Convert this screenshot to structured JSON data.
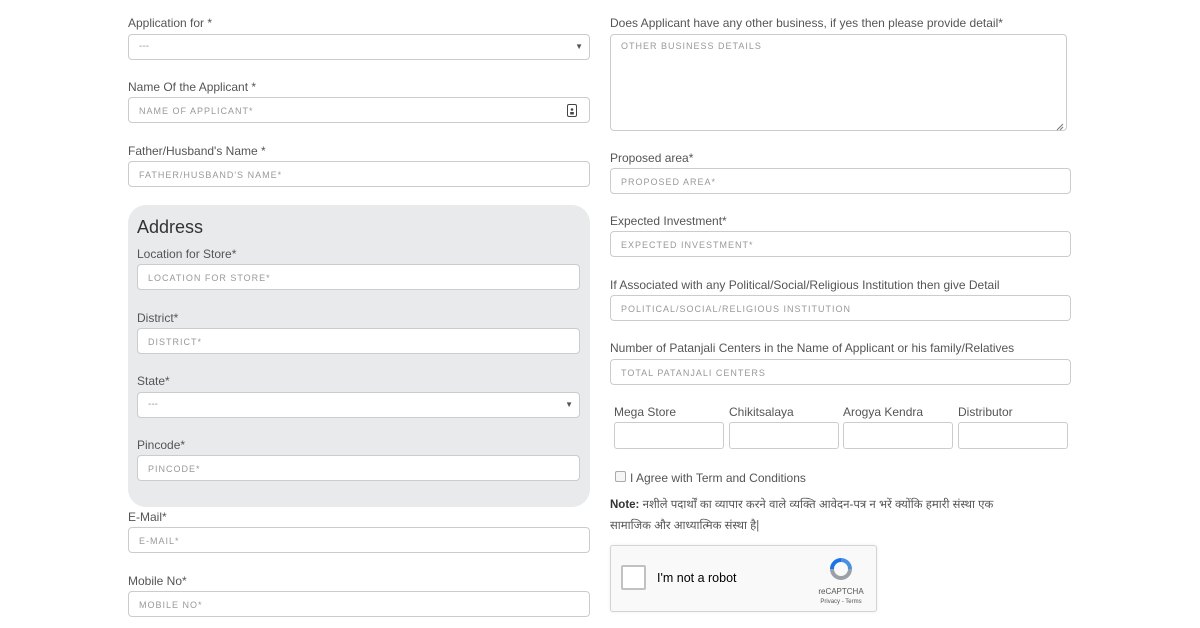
{
  "left": {
    "application_for": {
      "label": "Application for *",
      "value": "---"
    },
    "applicant_name": {
      "label": "Name Of the Applicant *",
      "placeholder": "NAME OF APPLICANT*"
    },
    "father_name": {
      "label": "Father/Husband's Name *",
      "placeholder": "FATHER/HUSBAND'S NAME*"
    },
    "address": {
      "title": "Address",
      "location": {
        "label": "Location for Store*",
        "placeholder": "LOCATION FOR STORE*"
      },
      "district": {
        "label": "District*",
        "placeholder": "DISTRICT*"
      },
      "state": {
        "label": "State*",
        "value": "---"
      },
      "pincode": {
        "label": "Pincode*",
        "placeholder": "PINCODE*"
      }
    },
    "email": {
      "label": "E-Mail*",
      "placeholder": "E-MAIL*"
    },
    "mobile": {
      "label": "Mobile No*",
      "placeholder": "MOBILE NO*"
    }
  },
  "right": {
    "other_business": {
      "label": "Does Applicant have any other business, if yes then please provide detail*",
      "placeholder": "OTHER BUSINESS DETAILS"
    },
    "proposed_area": {
      "label": "Proposed area*",
      "placeholder": "PROPOSED AREA*"
    },
    "investment": {
      "label": "Expected Investment*",
      "placeholder": "EXPECTED INVESTMENT*"
    },
    "political": {
      "label": "If Associated with any Political/Social/Religious Institution then give Detail",
      "placeholder": "POLITICAL/SOCIAL/RELIGIOUS INSTITUTION"
    },
    "centers": {
      "label": "Number of Patanjali Centers in the Name of Applicant or his family/Relatives",
      "placeholder": "TOTAL PATANJALI CENTERS"
    },
    "center_types": [
      "Mega Store",
      "Chikitsalaya",
      "Arogya Kendra",
      "Distributor"
    ],
    "agree_label": "I Agree with Term and Conditions",
    "note_prefix": "Note:",
    "note_line1": " नशीले पदार्थों का व्यापार करने वाले व्यक्ति आवेदन-पत्र न भरें क्योंकि हमारी संस्था एक",
    "note_line2": "सामाजिक और आध्यात्मिक संस्था है|",
    "recaptcha": {
      "label": "I'm not a robot",
      "brand": "reCAPTCHA",
      "links": "Privacy - Terms"
    }
  }
}
